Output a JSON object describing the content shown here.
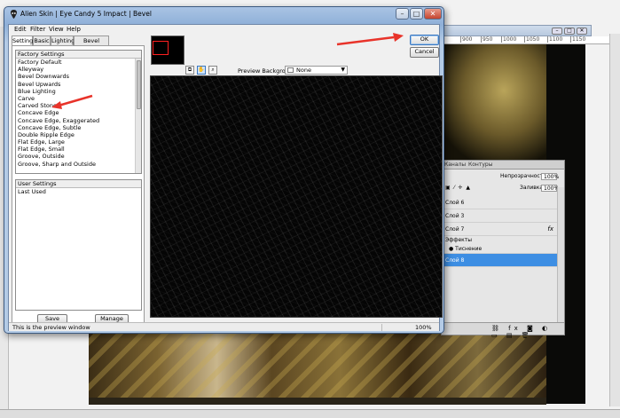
{
  "dialog": {
    "title": "Alien Skin | Eye Candy 5 Impact | Bevel",
    "menu": [
      "Edit",
      "Filter",
      "View",
      "Help"
    ],
    "tabs": [
      "Settings",
      "Basic",
      "Lighting",
      "Bevel Profile"
    ],
    "factory_settings": {
      "header": "Factory Settings",
      "items": [
        "Factory Default",
        "Alleyway",
        "Bevel Downwards",
        "Bevel Upwards",
        "Blue Lighting",
        "Carve",
        "Carved Stone",
        "Concave Edge",
        "Concave Edge, Exaggerated",
        "Concave Edge, Subtle",
        "Double Ripple Edge",
        "Flat Edge, Large",
        "Flat Edge, Small",
        "Groove, Outside",
        "Groove, Sharp and Outside"
      ]
    },
    "user_settings": {
      "header": "User Settings",
      "items": [
        "Last Used"
      ]
    },
    "buttons": {
      "save": "Save",
      "manage": "Manage",
      "ok": "OK",
      "cancel": "Cancel"
    },
    "preview_background": {
      "label": "Preview Background:",
      "value": "None"
    },
    "status": "This is the preview window",
    "zoom": "100%",
    "window_controls": {
      "minimize": "–",
      "maximize": "□",
      "close": "✕"
    }
  },
  "photoshop": {
    "ruler_numbers": [
      "900",
      "950",
      "1000",
      "1050",
      "1100",
      "1150"
    ],
    "layers_panel": {
      "tabs": [
        "Каналы",
        "Контуры"
      ],
      "opacity_label": "Непрозрачность:",
      "opacity_value": "100%",
      "fill_label": "Заливка:",
      "fill_value": "100%",
      "layers": [
        "Слой 6",
        "Слой 3",
        "Слой 7",
        "Эффекты",
        "Тиснение",
        "Слой 8"
      ],
      "fx_label": "fx"
    }
  },
  "colors": {
    "annotation_arrow": "#e8332a",
    "selected_layer": "#3d8ee3",
    "dialog_frame": "#a9c3e4"
  }
}
